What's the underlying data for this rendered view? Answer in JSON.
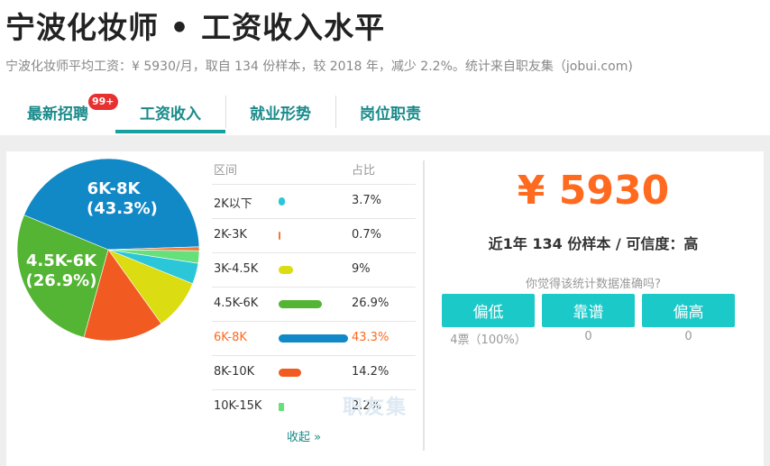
{
  "header": {
    "title": "宁波化妆师 • 工资收入水平",
    "subtitle": "宁波化妆师平均工资：¥ 5930/月，取自 134 份样本，较 2018 年，减少 2.2%。统计来自职友集（jobui.com)"
  },
  "tabs": [
    {
      "label": "最新招聘",
      "badge": "99+"
    },
    {
      "label": "工资收入"
    },
    {
      "label": "就业形势"
    },
    {
      "label": "岗位职责"
    }
  ],
  "table": {
    "col_range": "区间",
    "col_pct": "占比",
    "rows": [
      {
        "label": "2K以下",
        "pct": "3.7%",
        "value": 3.7,
        "color": "#2bc6d8"
      },
      {
        "label": "2K-3K",
        "pct": "0.7%",
        "value": 0.7,
        "color": "#f07a3a"
      },
      {
        "label": "3K-4.5K",
        "pct": "9%",
        "value": 9,
        "color": "#dcdc12"
      },
      {
        "label": "4.5K-6K",
        "pct": "26.9%",
        "value": 26.9,
        "color": "#54b433"
      },
      {
        "label": "6K-8K",
        "pct": "43.3%",
        "value": 43.3,
        "color": "#1289c7"
      },
      {
        "label": "8K-10K",
        "pct": "14.2%",
        "value": 14.2,
        "color": "#f15a20"
      },
      {
        "label": "10K-15K",
        "pct": "2.2%",
        "value": 2.2,
        "color": "#66e07a"
      }
    ],
    "collapse_label": "收起 »",
    "watermark": "职友集"
  },
  "pie": {
    "label_top_range": "6K-8K",
    "label_top_pct": "(43.3%)",
    "label_left_range": "4.5K-6K",
    "label_left_pct": "(26.9%)"
  },
  "summary": {
    "salary": "¥ 5930",
    "sample": "近1年 134 份样本 / 可信度：高",
    "question": "你觉得该统计数据准确吗?",
    "votes": [
      {
        "label": "偏低",
        "count": "4票（100%）"
      },
      {
        "label": "靠谱",
        "count": "0"
      },
      {
        "label": "偏高",
        "count": "0"
      }
    ]
  },
  "chart_data": {
    "type": "pie",
    "categories": [
      "2K以下",
      "2K-3K",
      "3K-4.5K",
      "4.5K-6K",
      "6K-8K",
      "8K-10K",
      "10K-15K"
    ],
    "values": [
      3.7,
      0.7,
      9,
      26.9,
      43.3,
      14.2,
      2.2
    ],
    "colors": [
      "#2bc6d8",
      "#f07a3a",
      "#dcdc12",
      "#54b433",
      "#1289c7",
      "#f15a20",
      "#66e07a"
    ]
  }
}
